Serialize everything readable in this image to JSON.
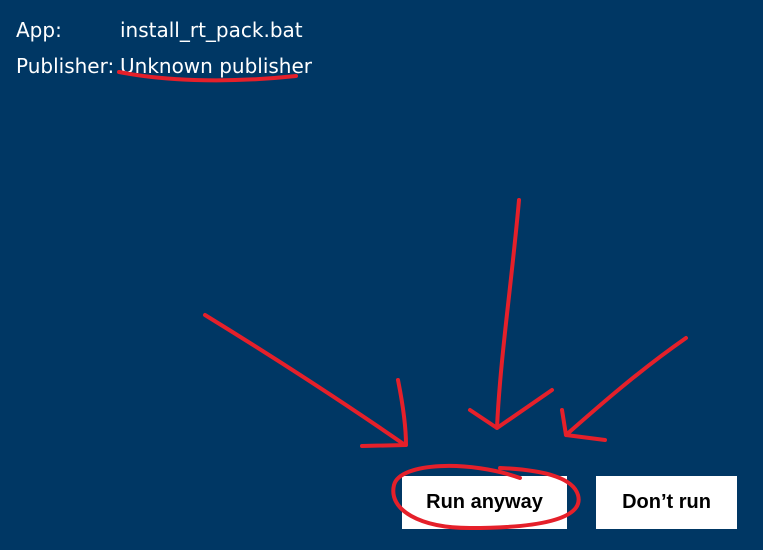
{
  "dialog": {
    "app_label": "App:",
    "app_value": "install_rt_pack.bat",
    "publisher_label": "Publisher:",
    "publisher_value": "Unknown publisher"
  },
  "buttons": {
    "run_anyway": "Run anyway",
    "dont_run": "Don’t run"
  },
  "colors": {
    "background": "#003764",
    "annotation": "#e5202a",
    "button_bg": "#ffffff"
  }
}
